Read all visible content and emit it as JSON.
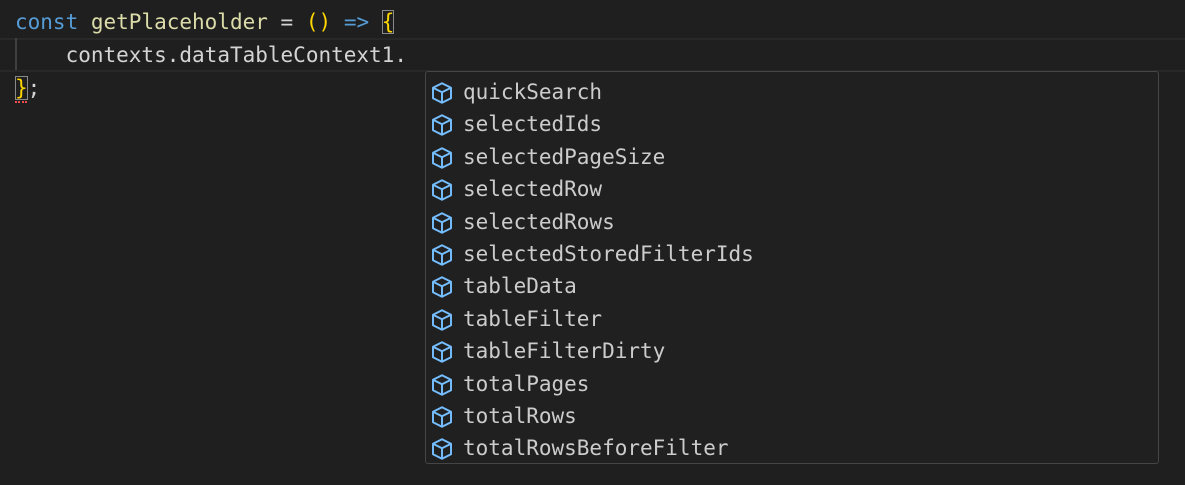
{
  "editor": {
    "line1": {
      "keyword": "const",
      "function_name": "getPlaceholder",
      "operator": "=",
      "parens": "()",
      "arrow": "=>",
      "brace_open": "{"
    },
    "line2": {
      "object": "contexts",
      "dot1": ".",
      "property": "dataTableContext1",
      "dot2": "."
    },
    "line3": {
      "brace_close": "}",
      "semicolon": ";"
    }
  },
  "suggestions": {
    "icon": "property-cube-icon",
    "icon_color": "#75beff",
    "items": [
      {
        "label": "quickSearch"
      },
      {
        "label": "selectedIds"
      },
      {
        "label": "selectedPageSize"
      },
      {
        "label": "selectedRow"
      },
      {
        "label": "selectedRows"
      },
      {
        "label": "selectedStoredFilterIds"
      },
      {
        "label": "tableData"
      },
      {
        "label": "tableFilter"
      },
      {
        "label": "tableFilterDirty"
      },
      {
        "label": "totalPages"
      },
      {
        "label": "totalRows"
      },
      {
        "label": "totalRowsBeforeFilter"
      }
    ]
  }
}
